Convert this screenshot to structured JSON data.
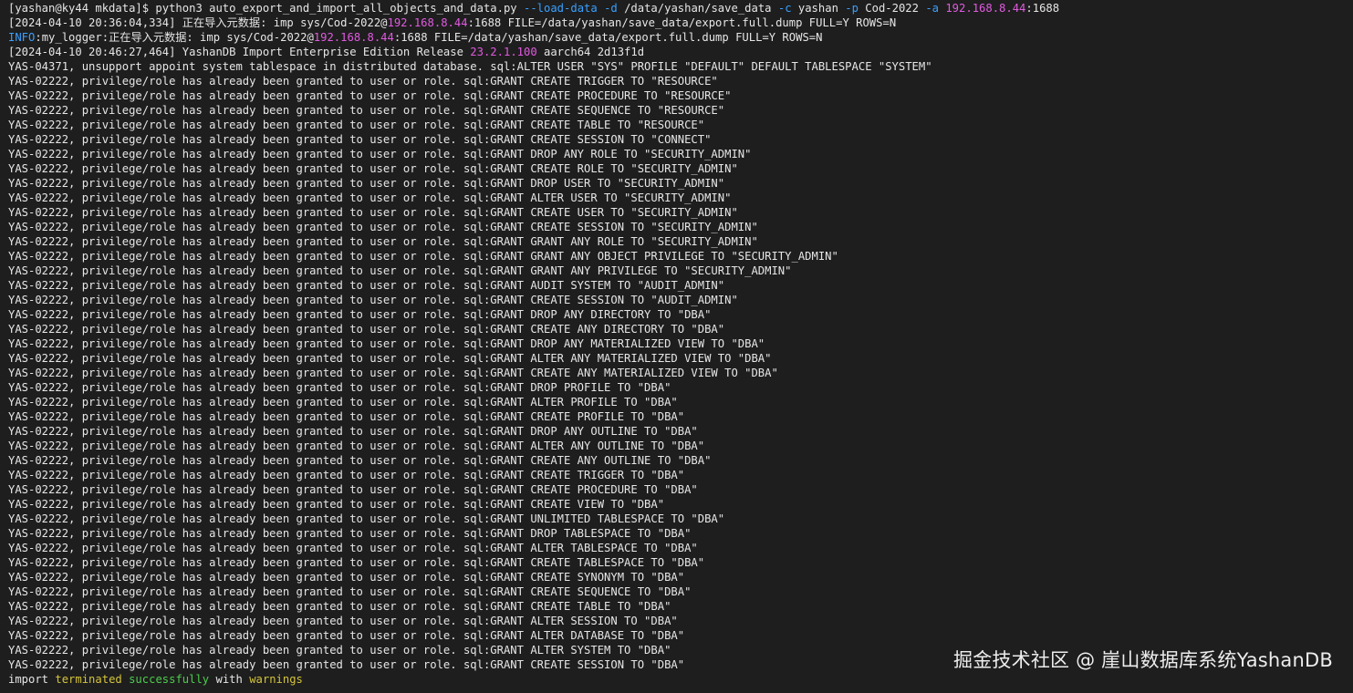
{
  "colors": {
    "background": "#1e1e1e",
    "text": "#e6e6e6",
    "option": "#3aa0ff",
    "ip_address": "#e05ae0",
    "info": "#3aa0ff",
    "version": "#e05ae0",
    "warning_yellow": "#d4c43c",
    "success_green": "#4ccd4c"
  },
  "terminal": {
    "lines": [
      {
        "segments": [
          {
            "t": "[yashan@ky44 mkdata]$ python3 auto_export_and_import_all_objects_and_data.py "
          },
          {
            "t": "--load-data",
            "c": "option"
          },
          {
            "t": " "
          },
          {
            "t": "-d",
            "c": "option"
          },
          {
            "t": " /data/yashan/save_data "
          },
          {
            "t": "-c",
            "c": "option"
          },
          {
            "t": " yashan "
          },
          {
            "t": "-p",
            "c": "option"
          },
          {
            "t": " Cod-2022 "
          },
          {
            "t": "-a",
            "c": "option"
          },
          {
            "t": " "
          },
          {
            "t": "192.168.8.44",
            "c": "ip_address"
          },
          {
            "t": ":1688"
          }
        ]
      },
      {
        "segments": [
          {
            "t": "[2024-04-10 20:36:04,334] 正在导入元数据: imp sys/Cod-2022@"
          },
          {
            "t": "192.168.8.44",
            "c": "ip_address"
          },
          {
            "t": ":1688 FILE=/data/yashan/save_data/export.full.dump FULL=Y ROWS=N"
          }
        ]
      },
      {
        "segments": [
          {
            "t": "INFO",
            "c": "info"
          },
          {
            "t": ":my_logger:正在导入元数据: imp sys/Cod-2022@"
          },
          {
            "t": "192.168.8.44",
            "c": "ip_address"
          },
          {
            "t": ":1688 FILE=/data/yashan/save_data/export.full.dump FULL=Y ROWS=N"
          }
        ]
      },
      {
        "segments": [
          {
            "t": "[2024-04-10 20:46:27,464] YashanDB Import Enterprise Edition Release "
          },
          {
            "t": "23.2.1.100",
            "c": "version"
          },
          {
            "t": " aarch64 2d13f1d"
          }
        ]
      },
      {
        "segments": [
          {
            "t": "YAS-04371, unsupport appoint system tablespace in distributed database. sql:ALTER USER \"SYS\" PROFILE \"DEFAULT\" DEFAULT TABLESPACE \"SYSTEM\""
          }
        ]
      },
      {
        "segments": [
          {
            "t": "YAS-02222, privilege/role has already been granted to user or role. sql:GRANT CREATE TRIGGER TO \"RESOURCE\""
          }
        ]
      },
      {
        "segments": [
          {
            "t": "YAS-02222, privilege/role has already been granted to user or role. sql:GRANT CREATE PROCEDURE TO \"RESOURCE\""
          }
        ]
      },
      {
        "segments": [
          {
            "t": "YAS-02222, privilege/role has already been granted to user or role. sql:GRANT CREATE SEQUENCE TO \"RESOURCE\""
          }
        ]
      },
      {
        "segments": [
          {
            "t": "YAS-02222, privilege/role has already been granted to user or role. sql:GRANT CREATE TABLE TO \"RESOURCE\""
          }
        ]
      },
      {
        "segments": [
          {
            "t": "YAS-02222, privilege/role has already been granted to user or role. sql:GRANT CREATE SESSION TO \"CONNECT\""
          }
        ]
      },
      {
        "segments": [
          {
            "t": "YAS-02222, privilege/role has already been granted to user or role. sql:GRANT DROP ANY ROLE TO \"SECURITY_ADMIN\""
          }
        ]
      },
      {
        "segments": [
          {
            "t": "YAS-02222, privilege/role has already been granted to user or role. sql:GRANT CREATE ROLE TO \"SECURITY_ADMIN\""
          }
        ]
      },
      {
        "segments": [
          {
            "t": "YAS-02222, privilege/role has already been granted to user or role. sql:GRANT DROP USER TO \"SECURITY_ADMIN\""
          }
        ]
      },
      {
        "segments": [
          {
            "t": "YAS-02222, privilege/role has already been granted to user or role. sql:GRANT ALTER USER TO \"SECURITY_ADMIN\""
          }
        ]
      },
      {
        "segments": [
          {
            "t": "YAS-02222, privilege/role has already been granted to user or role. sql:GRANT CREATE USER TO \"SECURITY_ADMIN\""
          }
        ]
      },
      {
        "segments": [
          {
            "t": "YAS-02222, privilege/role has already been granted to user or role. sql:GRANT CREATE SESSION TO \"SECURITY_ADMIN\""
          }
        ]
      },
      {
        "segments": [
          {
            "t": "YAS-02222, privilege/role has already been granted to user or role. sql:GRANT GRANT ANY ROLE TO \"SECURITY_ADMIN\""
          }
        ]
      },
      {
        "segments": [
          {
            "t": "YAS-02222, privilege/role has already been granted to user or role. sql:GRANT GRANT ANY OBJECT PRIVILEGE TO \"SECURITY_ADMIN\""
          }
        ]
      },
      {
        "segments": [
          {
            "t": "YAS-02222, privilege/role has already been granted to user or role. sql:GRANT GRANT ANY PRIVILEGE TO \"SECURITY_ADMIN\""
          }
        ]
      },
      {
        "segments": [
          {
            "t": "YAS-02222, privilege/role has already been granted to user or role. sql:GRANT AUDIT SYSTEM TO \"AUDIT_ADMIN\""
          }
        ]
      },
      {
        "segments": [
          {
            "t": "YAS-02222, privilege/role has already been granted to user or role. sql:GRANT CREATE SESSION TO \"AUDIT_ADMIN\""
          }
        ]
      },
      {
        "segments": [
          {
            "t": "YAS-02222, privilege/role has already been granted to user or role. sql:GRANT DROP ANY DIRECTORY TO \"DBA\""
          }
        ]
      },
      {
        "segments": [
          {
            "t": "YAS-02222, privilege/role has already been granted to user or role. sql:GRANT CREATE ANY DIRECTORY TO \"DBA\""
          }
        ]
      },
      {
        "segments": [
          {
            "t": "YAS-02222, privilege/role has already been granted to user or role. sql:GRANT DROP ANY MATERIALIZED VIEW TO \"DBA\""
          }
        ]
      },
      {
        "segments": [
          {
            "t": "YAS-02222, privilege/role has already been granted to user or role. sql:GRANT ALTER ANY MATERIALIZED VIEW TO \"DBA\""
          }
        ]
      },
      {
        "segments": [
          {
            "t": "YAS-02222, privilege/role has already been granted to user or role. sql:GRANT CREATE ANY MATERIALIZED VIEW TO \"DBA\""
          }
        ]
      },
      {
        "segments": [
          {
            "t": "YAS-02222, privilege/role has already been granted to user or role. sql:GRANT DROP PROFILE TO \"DBA\""
          }
        ]
      },
      {
        "segments": [
          {
            "t": "YAS-02222, privilege/role has already been granted to user or role. sql:GRANT ALTER PROFILE TO \"DBA\""
          }
        ]
      },
      {
        "segments": [
          {
            "t": "YAS-02222, privilege/role has already been granted to user or role. sql:GRANT CREATE PROFILE TO \"DBA\""
          }
        ]
      },
      {
        "segments": [
          {
            "t": "YAS-02222, privilege/role has already been granted to user or role. sql:GRANT DROP ANY OUTLINE TO \"DBA\""
          }
        ]
      },
      {
        "segments": [
          {
            "t": "YAS-02222, privilege/role has already been granted to user or role. sql:GRANT ALTER ANY OUTLINE TO \"DBA\""
          }
        ]
      },
      {
        "segments": [
          {
            "t": "YAS-02222, privilege/role has already been granted to user or role. sql:GRANT CREATE ANY OUTLINE TO \"DBA\""
          }
        ]
      },
      {
        "segments": [
          {
            "t": "YAS-02222, privilege/role has already been granted to user or role. sql:GRANT CREATE TRIGGER TO \"DBA\""
          }
        ]
      },
      {
        "segments": [
          {
            "t": "YAS-02222, privilege/role has already been granted to user or role. sql:GRANT CREATE PROCEDURE TO \"DBA\""
          }
        ]
      },
      {
        "segments": [
          {
            "t": "YAS-02222, privilege/role has already been granted to user or role. sql:GRANT CREATE VIEW TO \"DBA\""
          }
        ]
      },
      {
        "segments": [
          {
            "t": "YAS-02222, privilege/role has already been granted to user or role. sql:GRANT UNLIMITED TABLESPACE TO \"DBA\""
          }
        ]
      },
      {
        "segments": [
          {
            "t": "YAS-02222, privilege/role has already been granted to user or role. sql:GRANT DROP TABLESPACE TO \"DBA\""
          }
        ]
      },
      {
        "segments": [
          {
            "t": "YAS-02222, privilege/role has already been granted to user or role. sql:GRANT ALTER TABLESPACE TO \"DBA\""
          }
        ]
      },
      {
        "segments": [
          {
            "t": "YAS-02222, privilege/role has already been granted to user or role. sql:GRANT CREATE TABLESPACE TO \"DBA\""
          }
        ]
      },
      {
        "segments": [
          {
            "t": "YAS-02222, privilege/role has already been granted to user or role. sql:GRANT CREATE SYNONYM TO \"DBA\""
          }
        ]
      },
      {
        "segments": [
          {
            "t": "YAS-02222, privilege/role has already been granted to user or role. sql:GRANT CREATE SEQUENCE TO \"DBA\""
          }
        ]
      },
      {
        "segments": [
          {
            "t": "YAS-02222, privilege/role has already been granted to user or role. sql:GRANT CREATE TABLE TO \"DBA\""
          }
        ]
      },
      {
        "segments": [
          {
            "t": "YAS-02222, privilege/role has already been granted to user or role. sql:GRANT ALTER SESSION TO \"DBA\""
          }
        ]
      },
      {
        "segments": [
          {
            "t": "YAS-02222, privilege/role has already been granted to user or role. sql:GRANT ALTER DATABASE TO \"DBA\""
          }
        ]
      },
      {
        "segments": [
          {
            "t": "YAS-02222, privilege/role has already been granted to user or role. sql:GRANT ALTER SYSTEM TO \"DBA\""
          }
        ]
      },
      {
        "segments": [
          {
            "t": "YAS-02222, privilege/role has already been granted to user or role. sql:GRANT CREATE SESSION TO \"DBA\""
          }
        ]
      },
      {
        "segments": [
          {
            "t": "import "
          },
          {
            "t": "terminated",
            "c": "warning_yellow"
          },
          {
            "t": " "
          },
          {
            "t": "successfully",
            "c": "success_green"
          },
          {
            "t": " with "
          },
          {
            "t": "warnings",
            "c": "warning_yellow"
          }
        ]
      }
    ]
  },
  "watermark": {
    "text": "掘金技术社区 @ 崖山数据库系统YashanDB"
  }
}
